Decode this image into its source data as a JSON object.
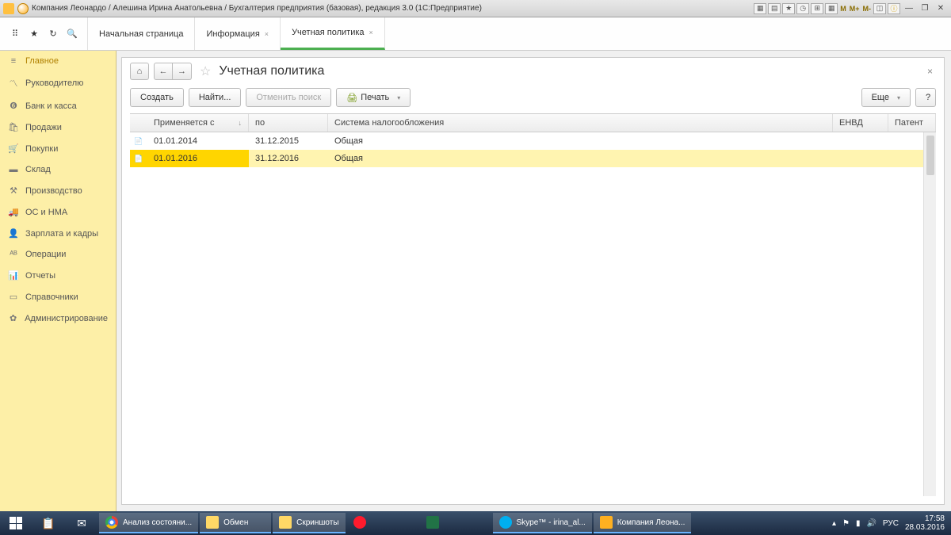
{
  "window": {
    "title": "Компания Леонардо / Алешина Ирина Анатольевна / Бухгалтерия предприятия (базовая), редакция 3.0  (1С:Предприятие)"
  },
  "tabs": {
    "t0": "Начальная страница",
    "t1": "Информация",
    "t2": "Учетная политика"
  },
  "sidebar": {
    "s0": {
      "label": "Главное"
    },
    "s1": {
      "label": "Руководителю"
    },
    "s2": {
      "label": "Банк и касса"
    },
    "s3": {
      "label": "Продажи"
    },
    "s4": {
      "label": "Покупки"
    },
    "s5": {
      "label": "Склад"
    },
    "s6": {
      "label": "Производство"
    },
    "s7": {
      "label": "ОС и НМА"
    },
    "s8": {
      "label": "Зарплата и кадры"
    },
    "s9": {
      "label": "Операции"
    },
    "s10": {
      "label": "Отчеты"
    },
    "s11": {
      "label": "Справочники"
    },
    "s12": {
      "label": "Администрирование"
    }
  },
  "page": {
    "title": "Учетная политика",
    "create": "Создать",
    "find": "Найти...",
    "cancelSearch": "Отменить поиск",
    "print": "Печать",
    "more": "Еще",
    "help": "?"
  },
  "grid": {
    "h1": "Применяется с",
    "h2": "по",
    "h3": "Система налогообложения",
    "h4": "ЕНВД",
    "h5": "Патент",
    "r0": {
      "from": "01.01.2014",
      "to": "31.12.2015",
      "sys": "Общая"
    },
    "r1": {
      "from": "01.01.2016",
      "to": "31.12.2016",
      "sys": "Общая"
    }
  },
  "taskbar": {
    "t0": "Анализ состояни...",
    "t1": "Обмен",
    "t2": "Скриншоты",
    "t3": "Skype™ - irina_al...",
    "t4": "Компания Леона...",
    "lang": "РУС",
    "time": "17:58",
    "date": "28.03.2016"
  }
}
